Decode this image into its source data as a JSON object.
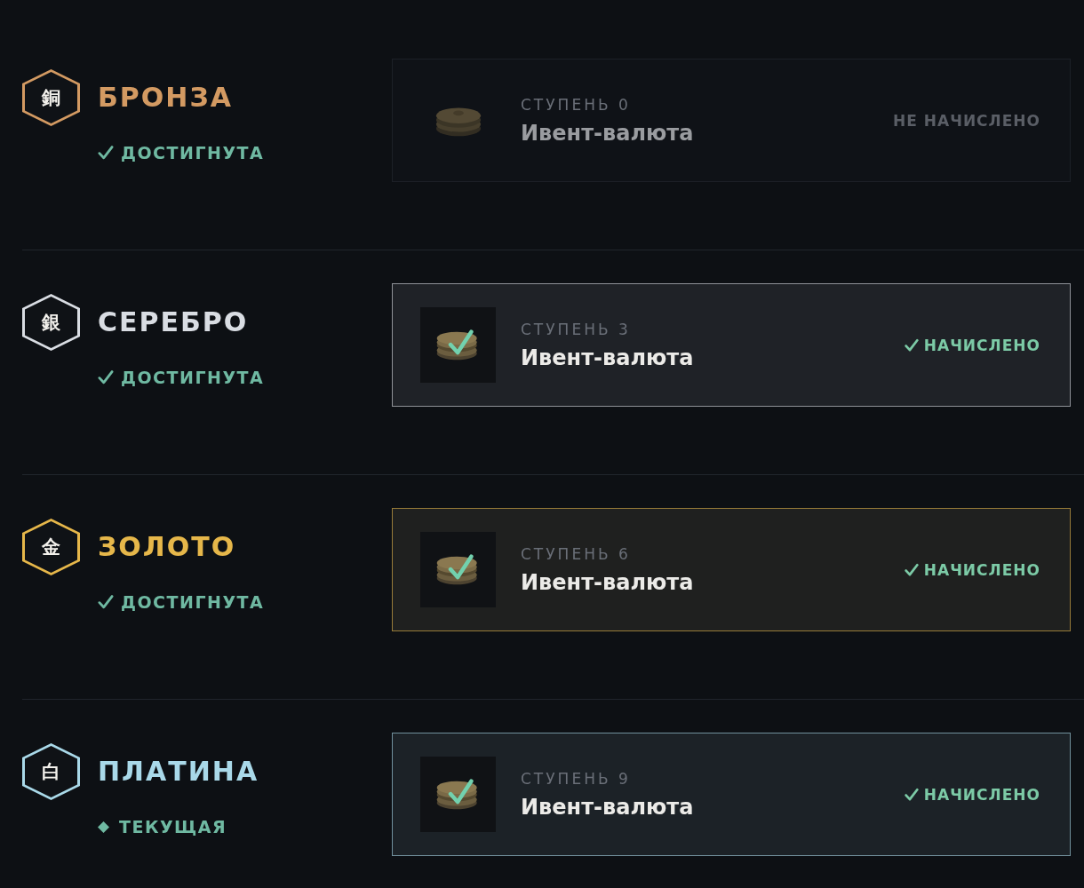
{
  "tiers": [
    {
      "emblem": "銅",
      "name": "БРОНЗА",
      "color": "#d39a62",
      "status": {
        "kind": "reached",
        "label": "ДОСТИГНУТА"
      },
      "reward": {
        "step": "СТУПЕНЬ 0",
        "name": "Ивент-валюта",
        "credited": false,
        "state_label": "НЕ НАЧИСЛЕНО"
      }
    },
    {
      "emblem": "銀",
      "name": "СЕРЕБРО",
      "color": "#d9dde3",
      "status": {
        "kind": "reached",
        "label": "ДОСТИГНУТА"
      },
      "reward": {
        "step": "СТУПЕНЬ 3",
        "name": "Ивент-валюта",
        "credited": true,
        "state_label": "НАЧИСЛЕНО"
      }
    },
    {
      "emblem": "金",
      "name": "ЗОЛОТО",
      "color": "#e6b74a",
      "status": {
        "kind": "reached",
        "label": "ДОСТИГНУТА"
      },
      "reward": {
        "step": "СТУПЕНЬ 6",
        "name": "Ивент-валюта",
        "credited": true,
        "state_label": "НАЧИСЛЕНО"
      }
    },
    {
      "emblem": "白",
      "name": "ПЛАТИНА",
      "color": "#a9d9e9",
      "status": {
        "kind": "current",
        "label": "ТЕКУЩАЯ"
      },
      "reward": {
        "step": "СТУПЕНЬ 9",
        "name": "Ивент-валюта",
        "credited": true,
        "state_label": "НАЧИСЛЕНО"
      }
    }
  ]
}
